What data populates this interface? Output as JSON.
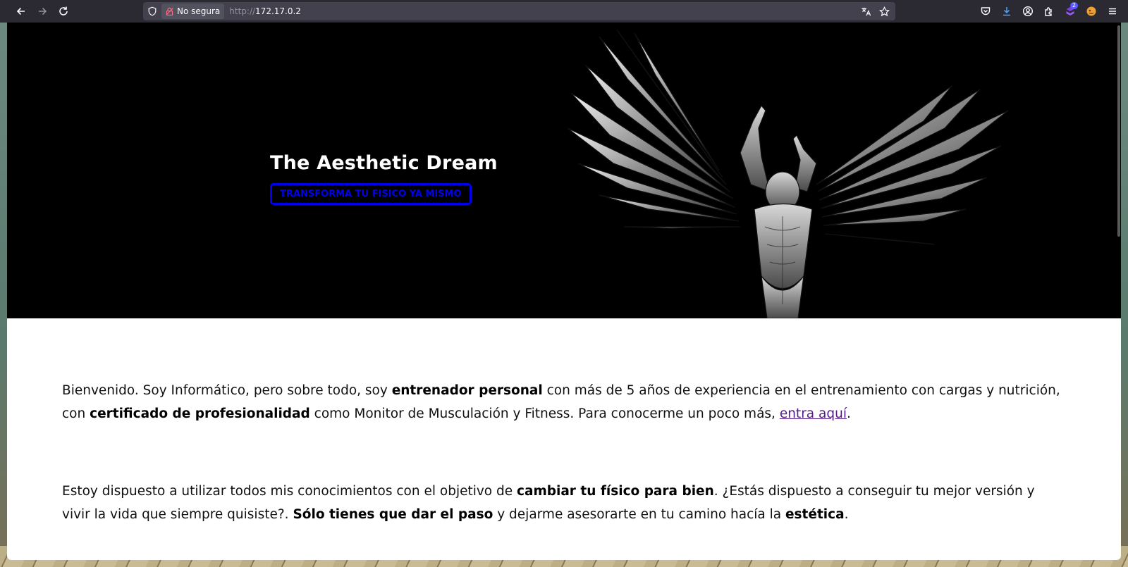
{
  "browser": {
    "security_label": "No segura",
    "url_scheme": "http://",
    "url_host": "172.17.0.2",
    "downloads_badge": "2"
  },
  "hero": {
    "title": "The Aesthetic Dream",
    "cta_label": "TRANSFORMA TU FISICO YA MISMO",
    "cta_color": "#0000ee",
    "background": "#000000"
  },
  "content": {
    "p1": {
      "t1": "Bienvenido. Soy Informático, pero sobre todo, soy ",
      "b1": "entrenador personal",
      "t2": " con más de 5 años de experiencia en el entrenamiento con cargas y nutrición, con ",
      "b2": "certificado de profesionalidad",
      "t3": " como Monitor de Musculación y Fitness. Para conocerme un poco más, ",
      "link": "entra aquí",
      "t4": "."
    },
    "p2": {
      "t1": "Estoy dispuesto a utilizar todos mis conocimientos con el objetivo de ",
      "b1": "cambiar tu físico para bien",
      "t2": ". ¿Estás dispuesto a conseguir tu mejor versión y vivir la vida que siempre quisiste?. ",
      "b2": "Sólo tienes que dar el paso",
      "t3": " y dejarme asesorarte en tu camino hacía la ",
      "b3": "estética",
      "t4": "."
    }
  }
}
